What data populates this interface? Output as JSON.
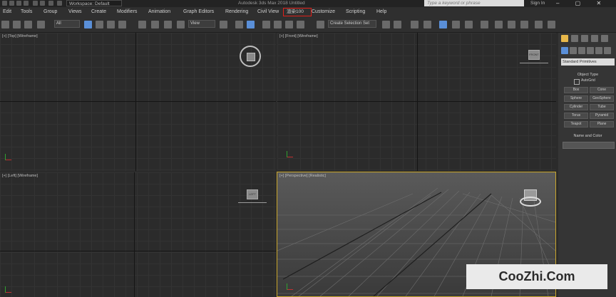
{
  "titlebar": {
    "workspace_label": "Workspace: Default",
    "app_title": "Autodesk 3ds Max 2018      Untitled",
    "search_placeholder": "Type a keyword or phrase",
    "sign_in": "Sign In",
    "window_controls": "– ▢ ✕"
  },
  "menubar": {
    "items": [
      "Edit",
      "Tools",
      "Group",
      "Views",
      "Create",
      "Modifiers",
      "Animation",
      "Graph Editors",
      "Rendering",
      "Civil View",
      "渲染100",
      "Customize",
      "Scripting",
      "Help"
    ],
    "highlighted_index": 10,
    "highlight_color": "#e0201a"
  },
  "toolbar": {
    "selection_filter": "All",
    "reference_coord": "View",
    "named_selection": "Create Selection Set"
  },
  "viewports": {
    "top": "[+] [Top] [Wireframe]",
    "front": "[+] [Front] [Wireframe]",
    "left": "[+] [Left] [Wireframe]",
    "perspective": "[+] [Perspective] [Realistic]",
    "active_border_color": "#c9a52b",
    "viewcube_labels": {
      "top": "TOP",
      "front": "FRONT",
      "left": "LEFT"
    }
  },
  "command_panel": {
    "category_dropdown": "Standard Primitives",
    "object_type_header": "Object Type",
    "autogrid_label": "AutoGrid",
    "buttons": [
      "Box",
      "Cone",
      "Sphere",
      "GeoSphere",
      "Cylinder",
      "Tube",
      "Torus",
      "Pyramid",
      "Teapot",
      "Plane"
    ],
    "name_color_header": "Name and Color",
    "active_tab_color": "#e8b84a"
  },
  "watermark": {
    "text": "CooZhi.Com"
  }
}
